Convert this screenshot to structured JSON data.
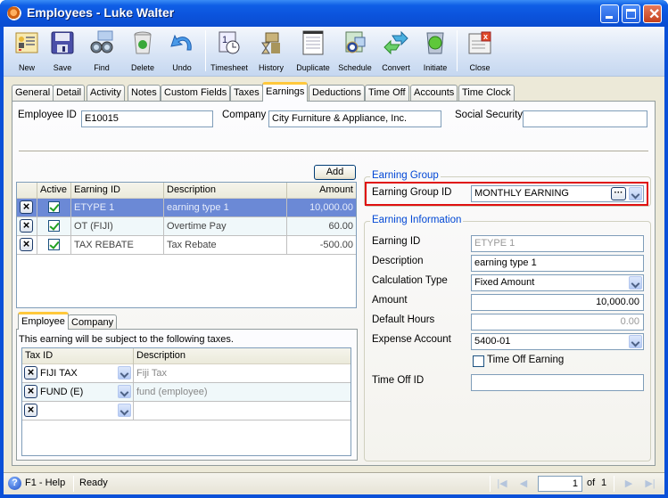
{
  "window": {
    "title": "Employees - Luke  Walter",
    "controls": [
      "minimize",
      "maximize",
      "close"
    ]
  },
  "toolbar": {
    "items": [
      {
        "label": "New",
        "icon": "new-record-icon"
      },
      {
        "label": "Save",
        "icon": "floppy-disk-icon"
      },
      {
        "label": "Find",
        "icon": "binoculars-icon"
      },
      {
        "label": "Delete",
        "icon": "recycle-bin-icon"
      },
      {
        "label": "Undo",
        "icon": "undo-arrow-icon"
      },
      {
        "label": "Timesheet",
        "icon": "timesheet-clock-icon"
      },
      {
        "label": "History",
        "icon": "history-hourglass-icon"
      },
      {
        "label": "Duplicate",
        "icon": "duplicate-pages-icon"
      },
      {
        "label": "Schedule",
        "icon": "schedule-calendar-icon"
      },
      {
        "label": "Convert",
        "icon": "convert-arrows-icon"
      },
      {
        "label": "Initiate",
        "icon": "traffic-light-icon"
      },
      {
        "label": "Close",
        "icon": "close-window-icon"
      }
    ]
  },
  "tabs": [
    {
      "label": "General"
    },
    {
      "label": "Detail"
    },
    {
      "label": "Activity"
    },
    {
      "label": "Notes"
    },
    {
      "label": "Custom Fields"
    },
    {
      "label": "Taxes"
    },
    {
      "label": "Earnings",
      "active": true
    },
    {
      "label": "Deductions"
    },
    {
      "label": "Time Off"
    },
    {
      "label": "Accounts"
    },
    {
      "label": "Time Clock"
    }
  ],
  "header": {
    "employee_id_label": "Employee ID",
    "employee_id": "E10015",
    "company_label": "Company",
    "company": "City Furniture & Appliance, Inc.",
    "ssn_label": "Social Security",
    "ssn": ""
  },
  "earnings_grid": {
    "add_label": "Add",
    "columns": [
      "",
      "Active",
      "Earning ID",
      "Description",
      "Amount"
    ],
    "rows": [
      {
        "active": true,
        "earning_id": "ETYPE 1",
        "description": "earning type 1",
        "amount": "10,000.00",
        "selected": true
      },
      {
        "active": true,
        "earning_id": "OT (FIJI)",
        "description": "Overtime Pay",
        "amount": "60.00"
      },
      {
        "active": true,
        "earning_id": "TAX REBATE",
        "description": "Tax Rebate",
        "amount": "-500.00"
      }
    ]
  },
  "subtabs": [
    {
      "label": "Employee",
      "active": true
    },
    {
      "label": "Company"
    }
  ],
  "taxes": {
    "caption": "This earning will be subject to the following taxes.",
    "columns": [
      "Tax ID",
      "Description"
    ],
    "rows": [
      {
        "tax_id": "FIJI TAX",
        "description": "Fiji Tax"
      },
      {
        "tax_id": "FUND (E)",
        "description": "fund (employee)"
      },
      {
        "tax_id": "",
        "description": ""
      }
    ]
  },
  "earning_group": {
    "title": "Earning Group",
    "id_label": "Earning Group ID",
    "id_value": "MONTHLY EARNING",
    "ellipsis": "···"
  },
  "earning_info": {
    "title": "Earning Information",
    "earning_id_label": "Earning ID",
    "earning_id": "ETYPE 1",
    "description_label": "Description",
    "description": "earning type 1",
    "calc_type_label": "Calculation Type",
    "calc_type": "Fixed Amount",
    "amount_label": "Amount",
    "amount": "10,000.00",
    "default_hours_label": "Default Hours",
    "default_hours": "0.00",
    "expense_account_label": "Expense Account",
    "expense_account": "5400-01",
    "time_off_earning_label": "Time Off Earning",
    "time_off_earning": false,
    "time_off_id_label": "Time Off ID",
    "time_off_id": ""
  },
  "statusbar": {
    "help": "F1 - Help",
    "status": "Ready",
    "page": "1",
    "of_label": "of",
    "total": "1"
  },
  "colors": {
    "title_bar": "#0b53dc",
    "selected_row": "#6b89d6",
    "group_title": "#0046d5",
    "highlight_box": "#e01010",
    "active_tab_accent": "#ffc83c"
  }
}
